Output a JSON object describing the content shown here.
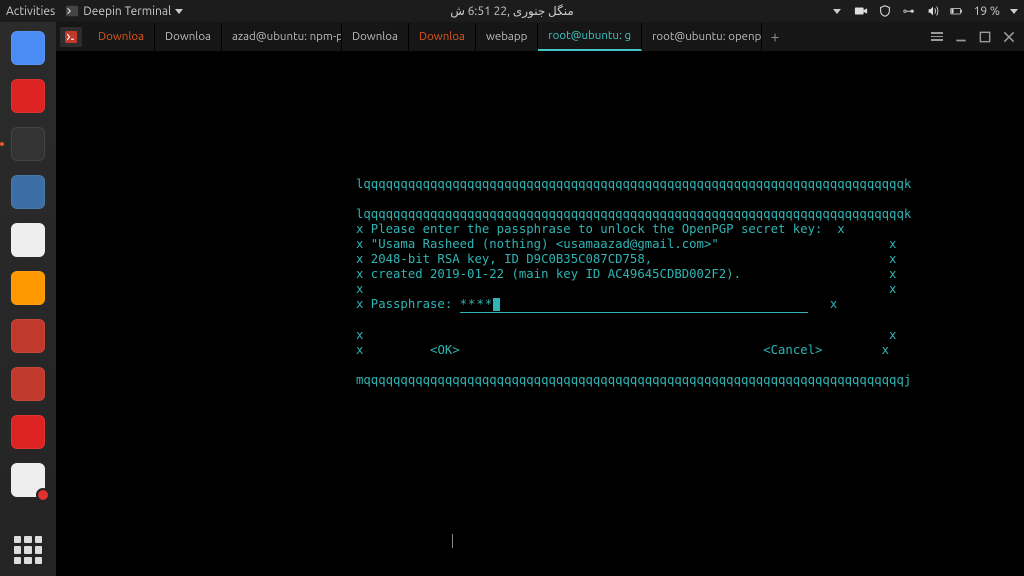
{
  "topbar": {
    "activities": "Activities",
    "app_name": "Deepin Terminal",
    "clock": "منگل جنوری ,22  6:51 ش",
    "battery": "19 %"
  },
  "tabs": [
    {
      "label": "Downloa",
      "highlight": true,
      "active": false
    },
    {
      "label": "Downloa",
      "highlight": false,
      "active": false
    },
    {
      "label": "azad@ubuntu: npm-pro",
      "highlight": false,
      "active": false
    },
    {
      "label": "Downloa",
      "highlight": false,
      "active": false
    },
    {
      "label": "Downloa",
      "highlight": true,
      "active": false
    },
    {
      "label": "webapp",
      "highlight": false,
      "active": false
    },
    {
      "label": "root@ubuntu: g",
      "highlight": false,
      "active": true
    },
    {
      "label": "root@ubuntu: openpgp-rev",
      "highlight": false,
      "active": false
    }
  ],
  "dialog": {
    "top_border": "lqqqqqqqqqqqqqqqqqqqqqqqqqqqqqqqqqqqqqqqqqqqqqqqqqqqqqqqqqqqqqqqqqqqqqqqqqk",
    "line1": "x Please enter the passphrase to unlock the OpenPGP secret key:  x",
    "line2": "x \"Usama Rasheed (nothing) <usamaazad@gmail.com>\"                       x",
    "line3": "x 2048-bit RSA key, ID D9C0B35C087CD758,                                x",
    "line4": "x created 2019-01-22 (main key ID AC49645CDBD002F2).                    x",
    "blank": "x                                                                       x",
    "pass_label": "x Passphrase: ",
    "pass_value": "****",
    "pass_tail": "   x",
    "ok_label": "<OK>",
    "cancel_label": "<Cancel>",
    "buttons_row_l": "x         ",
    "buttons_row_m": "                                         ",
    "buttons_row_r": "        x",
    "bottom_border": "mqqqqqqqqqqqqqqqqqqqqqqqqqqqqqqqqqqqqqqqqqqqqqqqqqqqqqqqqqqqqqqqqqqqqqqqqqj",
    "pre_border": "lqqqqqqqqqqqqqqqqqqqqqqqqqqqqqqqqqqqqqqqqqqqqqqqqqqqqqqqqqqqqqqqqqqqqqqqqqk"
  },
  "dock": {
    "items": [
      {
        "name": "chromium",
        "color": "#4b8bf4"
      },
      {
        "name": "opera",
        "color": "#d22"
      },
      {
        "name": "terminal",
        "color": "#333",
        "active": true
      },
      {
        "name": "files",
        "color": "#3a6ea5"
      },
      {
        "name": "rhythmbox",
        "color": "#eee"
      },
      {
        "name": "sublime",
        "color": "#ff9800"
      },
      {
        "name": "meld1",
        "color": "#c0392b"
      },
      {
        "name": "meld2",
        "color": "#c0392b"
      },
      {
        "name": "recorder",
        "color": "#d22"
      },
      {
        "name": "notes",
        "color": "#eee",
        "badge": true
      }
    ]
  }
}
